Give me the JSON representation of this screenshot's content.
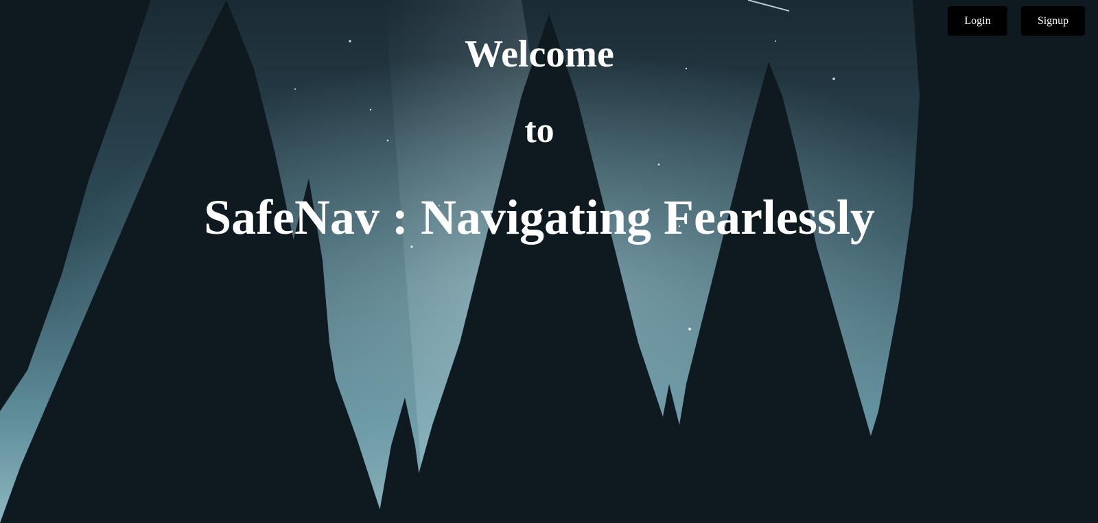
{
  "nav": {
    "login_label": "Login",
    "signup_label": "Signup"
  },
  "hero": {
    "line1": "Welcome",
    "line2": "to",
    "line3": "SafeNav : Navigating Fearlessly"
  },
  "colors": {
    "sky_top": "#1b2a33",
    "sky_mid": "#3f6a78",
    "sky_glow": "#9cc6d0",
    "tree_dark": "#0f1a20",
    "button_bg": "#000000",
    "text": "#ffffff"
  }
}
